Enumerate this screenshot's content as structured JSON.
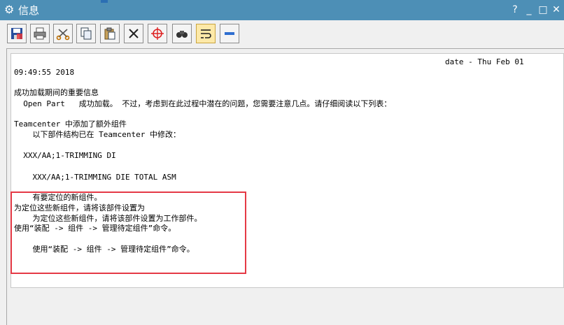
{
  "window": {
    "title": "信息",
    "help": "?",
    "minimize": "_",
    "maximize": "□",
    "close": "✕",
    "settings_icon": "gear-icon"
  },
  "toolbar": {
    "buttons": [
      {
        "name": "save-button",
        "icon": "save-icon"
      },
      {
        "name": "print-button",
        "icon": "printer-icon"
      },
      {
        "name": "cut-button",
        "icon": "scissors-icon"
      },
      {
        "name": "copy-button",
        "icon": "copy-icon"
      },
      {
        "name": "paste-button",
        "icon": "clipboard-icon"
      },
      {
        "name": "delete-button",
        "icon": "x-icon"
      },
      {
        "name": "crosshair-button",
        "icon": "crosshair-icon"
      },
      {
        "name": "find-button",
        "icon": "binoculars-icon"
      },
      {
        "name": "wrap-button",
        "icon": "word-wrap-icon",
        "active": true
      },
      {
        "name": "collapse-button",
        "icon": "minus-icon"
      }
    ]
  },
  "info": {
    "line1": "date - Thu Feb 01",
    "line2": "09:49:55 2018",
    "line3": "成功加载期间的重要信息",
    "line4": "  Open Part   成功加载。 不过，考虑到在此过程中潜在的问题，您需要注意几点。请仔细阅读以下列表：",
    "line5": "Teamcenter 中添加了额外组件",
    "line6": "    以下部件结构已在 Teamcenter 中修改：",
    "line7": "  XXX/AA;1-TRIMMING DI",
    "line8": "    XXX/AA;1-TRIMMING DIE TOTAL ASM",
    "line9": "    有要定位的新组件。",
    "line10": "为定位这些新组件，请将该部件设置为",
    "line11": "    为定位这些新组件，请将该部件设置为工作部件。",
    "line12": "使用“装配 -> 组件 -> 管理待定组件”命令。",
    "line13": "    使用“装配 -> 组件 -> 管理待定组件”命令。"
  },
  "colors": {
    "titlebar": "#4d8fb6",
    "highlight_box": "#e53945"
  }
}
